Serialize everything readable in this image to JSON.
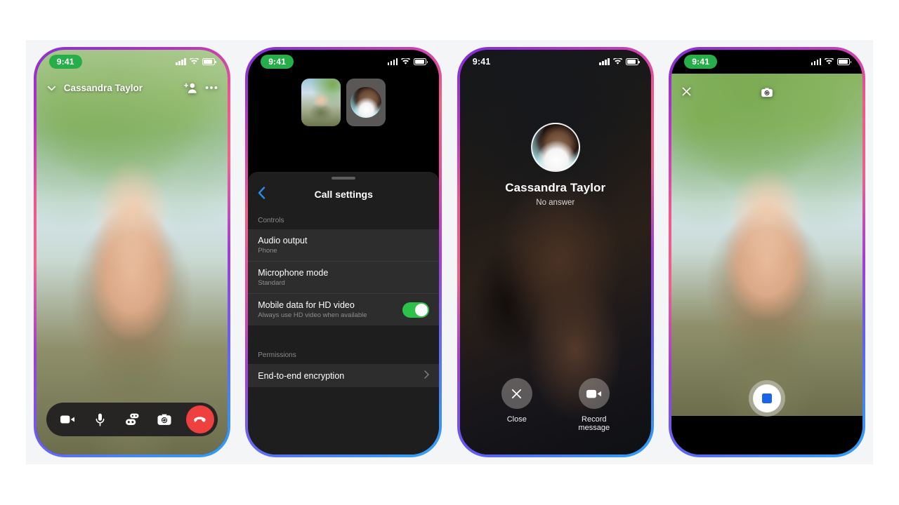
{
  "screens": [
    {
      "id": "active-call",
      "status": {
        "time": "9:41",
        "time_style": "pill",
        "icons": [
          "signal-bars",
          "wifi",
          "battery"
        ]
      },
      "header": {
        "collapse_icon": "chevron-down-icon",
        "title": "Cassandra Taylor",
        "add_person_icon": "add-person-icon",
        "more_icon": "more-options-icon"
      },
      "controls": [
        {
          "name": "video-toggle",
          "icon": "video-camera-icon"
        },
        {
          "name": "mic-toggle",
          "icon": "microphone-icon"
        },
        {
          "name": "effects",
          "icon": "effects-icon"
        },
        {
          "name": "flip-camera",
          "icon": "camera-flip-icon"
        },
        {
          "name": "end-call",
          "icon": "end-call-icon",
          "color": "#ef4040"
        }
      ]
    },
    {
      "id": "call-settings",
      "status": {
        "time": "9:41",
        "time_style": "pill",
        "icons": [
          "signal-bars",
          "wifi",
          "battery"
        ]
      },
      "pip": [
        {
          "name": "self-video-tile",
          "type": "video"
        },
        {
          "name": "participant-avatar-tile",
          "type": "avatar"
        }
      ],
      "sheet": {
        "back_icon": "back-chevron-icon",
        "title": "Call settings",
        "sections": [
          {
            "label": "Controls",
            "rows": [
              {
                "title": "Audio output",
                "subtitle": "Phone",
                "accessory": "none"
              },
              {
                "title": "Microphone mode",
                "subtitle": "Standard",
                "accessory": "none"
              },
              {
                "title": "Mobile data for HD video",
                "subtitle": "Always use HD video when available",
                "accessory": "toggle",
                "toggle_on": true,
                "toggle_color": "#2dc24a"
              }
            ]
          },
          {
            "label": "Permissions",
            "rows": [
              {
                "title": "End-to-end encryption",
                "subtitle": "",
                "accessory": "chevron"
              }
            ]
          }
        ]
      }
    },
    {
      "id": "no-answer",
      "status": {
        "time": "9:41",
        "time_style": "plain",
        "icons": [
          "signal-bars",
          "wifi",
          "battery"
        ]
      },
      "contact": {
        "name": "Cassandra Taylor",
        "status": "No answer",
        "avatar": "contact-avatar"
      },
      "actions": [
        {
          "name": "close",
          "label": "Close",
          "icon": "close-x-icon"
        },
        {
          "name": "record-message",
          "label": "Record message",
          "icon": "video-camera-icon"
        }
      ]
    },
    {
      "id": "record-message",
      "status": {
        "time": "9:41",
        "time_style": "pill",
        "icons": [
          "signal-bars",
          "wifi",
          "battery"
        ]
      },
      "top": {
        "close_icon": "close-x-icon",
        "flip_icon": "camera-flip-icon"
      },
      "record": {
        "name": "stop-recording-button",
        "icon": "stop-square-icon",
        "accent": "#1b63e8"
      }
    }
  ],
  "theme": {
    "panel_bg": "#f4f5f7",
    "page_bg": "#ffffff",
    "sheet_bg": "#1e1e1e",
    "row_bg": "#2d2d2d",
    "accent_blue": "#2e8ae6",
    "toggle_green": "#2dc24a",
    "endcall_red": "#ef4040",
    "time_pill_green": "#27ae4a"
  }
}
